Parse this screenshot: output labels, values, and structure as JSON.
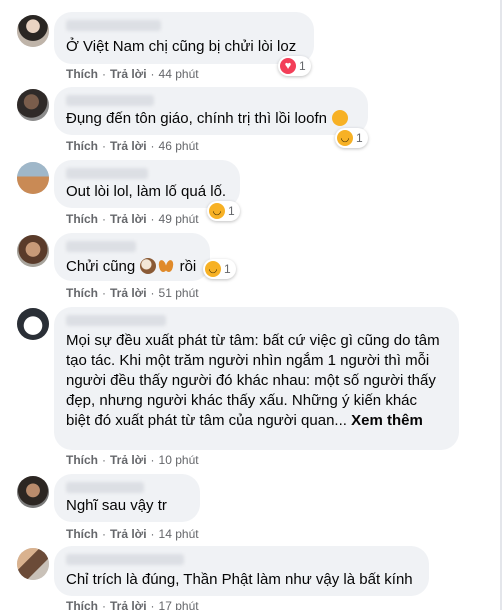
{
  "comments": [
    {
      "text": "Ở Việt Nam chị cũng bị chửi lòi loz",
      "like": "Thích",
      "reply": "Trả lời",
      "time": "44 phút",
      "reaction": {
        "type": "love-icon",
        "count": "1"
      }
    },
    {
      "text": "Đụng đến tôn giáo, chính trị thì lồi loofn",
      "like": "Thích",
      "reply": "Trả lời",
      "time": "46 phút",
      "reaction": {
        "type": "haha-icon",
        "count": "1"
      }
    },
    {
      "text": "Out lòi lol, làm lố quá lố.",
      "like": "Thích",
      "reply": "Trả lời",
      "time": "49 phút",
      "reaction": {
        "type": "haha-icon",
        "count": "1"
      }
    },
    {
      "text_before": "Chửi cũng",
      "text_after": "rồi",
      "like": "Thích",
      "reply": "Trả lời",
      "time": "51 phút",
      "reaction": {
        "type": "haha-icon",
        "count": "1"
      }
    },
    {
      "text": "Mọi sự đều xuất phát từ tâm: bất cứ việc gì cũng do tâm tạo tác. Khi một trăm người nhìn ngắm 1 người thì mỗi người đều thấy người đó khác nhau: một số người thấy đẹp, nhưng người khác thấy xấu. Những ý kiến khác biệt đó xuất phát từ tâm của người quan...",
      "see_more": "Xem thêm",
      "like": "Thích",
      "reply": "Trả lời",
      "time": "10 phút"
    },
    {
      "text": "Nghĩ sau vậy tr",
      "like": "Thích",
      "reply": "Trả lời",
      "time": "14 phút"
    },
    {
      "text": "Chỉ trích là đúng, Thần Phật làm như vậy là bất kính",
      "like": "Thích",
      "reply": "Trả lời",
      "time": "17 phút"
    }
  ],
  "colors": {
    "bubble": "#f0f2f5",
    "love": "#f33e58",
    "haha": "#f7b125",
    "meta": "#65676b"
  }
}
